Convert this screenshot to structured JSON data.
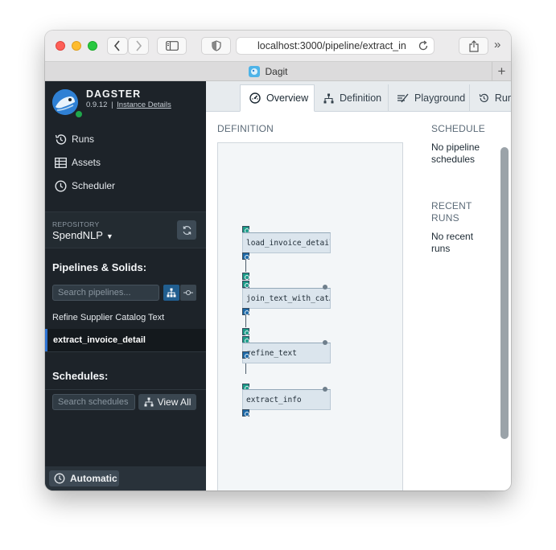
{
  "browser": {
    "url": "localhost:3000/pipeline/extract_in",
    "tab_title": "Dagit",
    "new_tab_label": "+",
    "more_label": "»"
  },
  "sidebar": {
    "brand": "DAGSTER",
    "version": "0.9.12",
    "version_sep": "|",
    "instance_link": "Instance Details",
    "nav": [
      {
        "label": "Runs",
        "icon": "history-icon"
      },
      {
        "label": "Assets",
        "icon": "table-icon"
      },
      {
        "label": "Scheduler",
        "icon": "clock-icon"
      }
    ],
    "repository_label": "REPOSITORY",
    "repository_name": "SpendNLP",
    "pipelines_title": "Pipelines & Solids:",
    "pipelines_search_placeholder": "Search pipelines...",
    "pipelines": [
      "Refine Supplier Catalog Text",
      "extract_invoice_detail"
    ],
    "active_pipeline": "extract_invoice_detail",
    "schedules_title": "Schedules:",
    "schedules_search_placeholder": "Search schedules",
    "view_all_label": "View All",
    "automatic_label": "Automatic"
  },
  "main": {
    "tabs": [
      {
        "label": "Overview",
        "icon": "dashboard-icon",
        "active": true
      },
      {
        "label": "Definition",
        "icon": "flow-tree-icon",
        "active": false
      },
      {
        "label": "Playground",
        "icon": "playground-icon",
        "active": false
      },
      {
        "label": "Runs",
        "icon": "history-icon",
        "active": false
      }
    ],
    "definition_title": "DEFINITION",
    "solids": [
      "load_invoice_detail",
      "join_text_with_cat…",
      "refine_text",
      "extract_info"
    ],
    "schedule_title": "SCHEDULE",
    "schedule_text": "No pipeline schedules",
    "recent_runs_title": "RECENT RUNS",
    "recent_runs_text": "No recent runs"
  },
  "colors": {
    "sidebar_bg": "#1d2329",
    "accent_blue": "#2d72d2",
    "input_port": "#1c9c88",
    "output_port": "#1e6aa8"
  }
}
